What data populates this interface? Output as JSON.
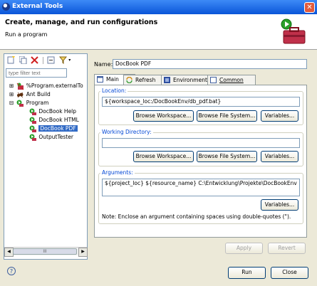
{
  "window": {
    "title": "External Tools"
  },
  "header": {
    "title": "Create, manage, and run configurations",
    "subtitle": "Run a program"
  },
  "filter": {
    "placeholder": "type filter text"
  },
  "tree": {
    "items": [
      {
        "label": "%Program.externalTo",
        "level": 0,
        "expander": "+"
      },
      {
        "label": "Ant Build",
        "level": 0,
        "expander": "+"
      },
      {
        "label": "Program",
        "level": 0,
        "expander": "-"
      },
      {
        "label": "DocBook Help",
        "level": 1
      },
      {
        "label": "DocBook HTML",
        "level": 1
      },
      {
        "label": "DocBook PDF",
        "level": 1,
        "selected": true
      },
      {
        "label": "OutputTester",
        "level": 1
      }
    ]
  },
  "name": {
    "label": "Name:",
    "value": "DocBook PDF"
  },
  "tabs": [
    {
      "label": "Main",
      "active": true
    },
    {
      "label": "Refresh"
    },
    {
      "label": "Environment"
    },
    {
      "label": "Common"
    }
  ],
  "location": {
    "label": "Location:",
    "value": "${workspace_loc:/DocBookEnv/db_pdf.bat}",
    "browse_workspace": "Browse Workspace...",
    "browse_fs": "Browse File System...",
    "variables": "Variables..."
  },
  "working_dir": {
    "label": "Working Directory:",
    "value": "",
    "browse_workspace": "Browse Workspace...",
    "browse_fs": "Browse File System...",
    "variables": "Variables..."
  },
  "arguments": {
    "label": "Arguments:",
    "value": "${project_loc} ${resource_name} C:\\Entwicklung\\Projekte\\DocBookEnv",
    "variables": "Variables...",
    "note": "Note: Enclose an argument containing spaces using double-quotes (\")."
  },
  "actions": {
    "apply": "Apply",
    "revert": "Revert"
  },
  "footer": {
    "run": "Run",
    "close": "Close",
    "help": "?"
  }
}
